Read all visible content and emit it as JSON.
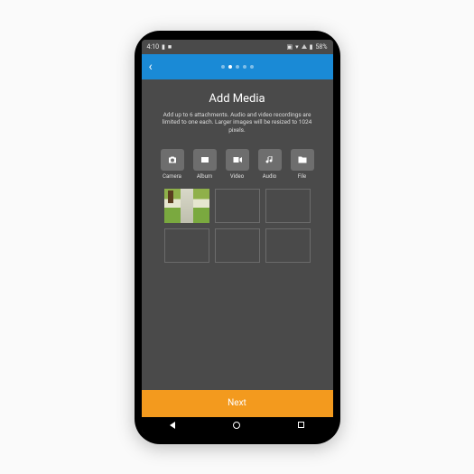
{
  "statusbar": {
    "time": "4:10",
    "battery": "58%"
  },
  "header": {
    "progress_dots": 5,
    "active_dot": 1
  },
  "screen": {
    "title": "Add Media",
    "description": "Add up to 6 attachments. Audio and video recordings are limited to one each. Larger images will be resized to 1024 pixels."
  },
  "options": [
    {
      "key": "camera",
      "label": "Camera"
    },
    {
      "key": "album",
      "label": "Album"
    },
    {
      "key": "video",
      "label": "Video"
    },
    {
      "key": "audio",
      "label": "Audio"
    },
    {
      "key": "file",
      "label": "File"
    }
  ],
  "slots": {
    "total": 6,
    "filled": 1
  },
  "footer": {
    "next_label": "Next"
  }
}
